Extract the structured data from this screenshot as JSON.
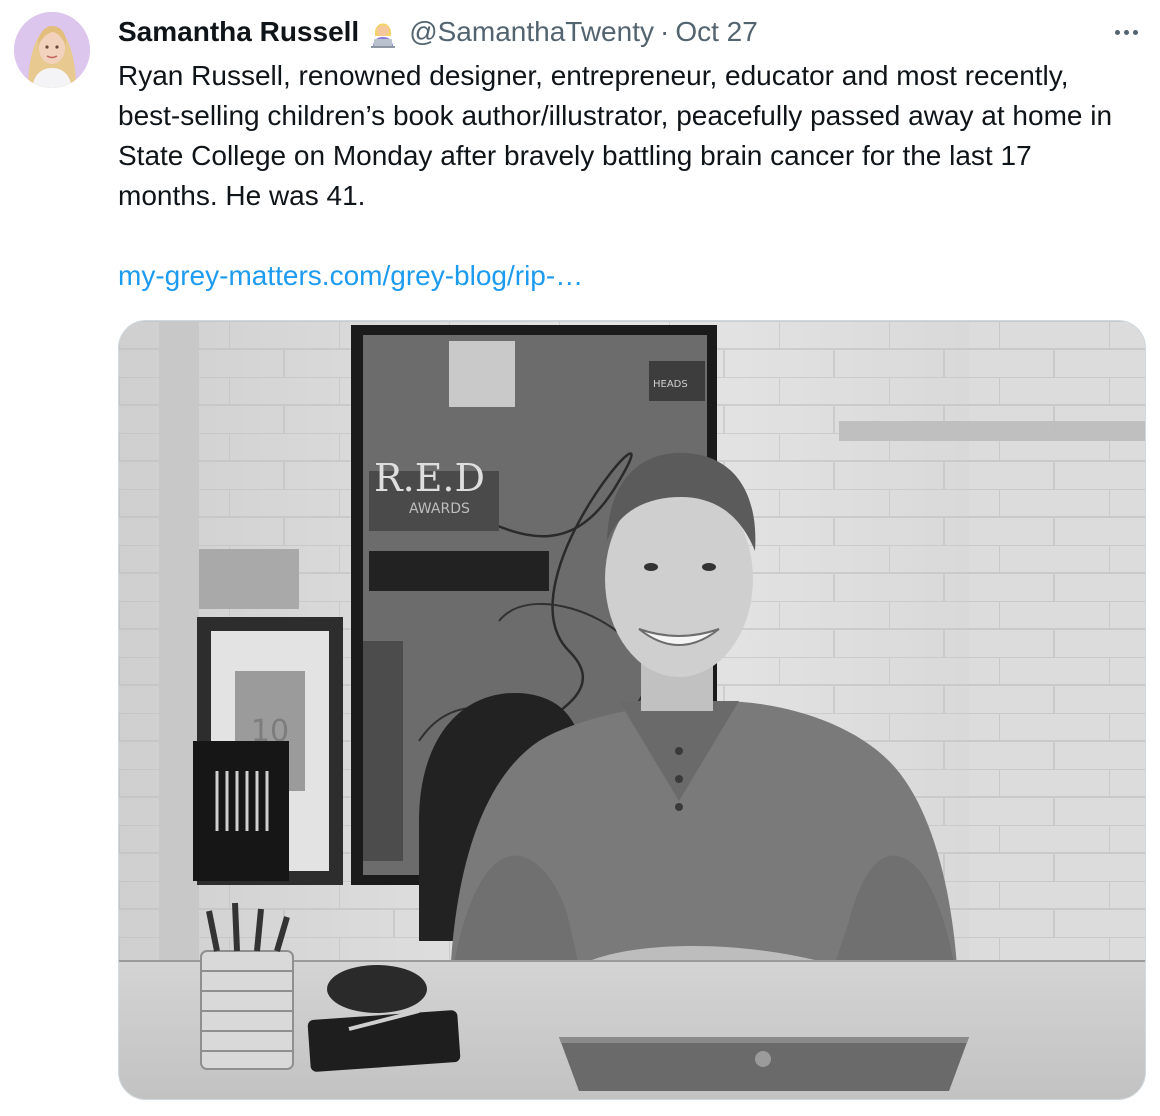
{
  "author": {
    "display_name": "Samantha Russell",
    "handle": "@SamanthaTwenty",
    "separator": "·",
    "date": "Oct 27",
    "emoji_icon": "woman-technologist-emoji"
  },
  "tweet": {
    "text": "Ryan Russell, renowned designer, entrepreneur, educator and most recently, best-selling children’s book author/illustrator, peacefully passed away at home in State College on Monday after bravely battling brain cancer for the last 17 months. He was 41.",
    "link": "my-grey-matters.com/grey-blog/rip-…"
  },
  "media": {
    "poster_text": "R.E.D",
    "poster_subtext": "AWARDS",
    "frame_number": "10",
    "sign_text": "HEADS"
  },
  "colors": {
    "text": "#0f1419",
    "secondary": "#536471",
    "link": "#1d9bf0",
    "border": "#cfd9de",
    "avatar_bg": "#d9c2ea"
  }
}
